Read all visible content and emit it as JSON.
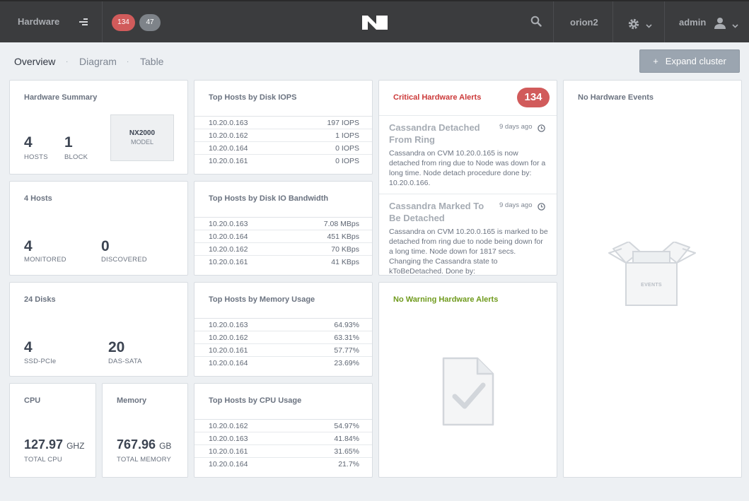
{
  "topbar": {
    "title": "Hardware",
    "critical_count": "134",
    "warning_count": "47",
    "cluster_name": "orion2",
    "user": "admin",
    "icons": [
      "menu-icon",
      "nutanix-logo",
      "search-icon",
      "gear-icon",
      "user-icon",
      "chevron-down-icon"
    ]
  },
  "subnav": {
    "tabs": [
      "Overview",
      "Diagram",
      "Table"
    ],
    "separator": "·"
  },
  "expand_button": {
    "icon": "+",
    "label": "Expand cluster"
  },
  "summary": {
    "title": "Hardware Summary",
    "hosts_value": "4",
    "hosts_label": "HOSTS",
    "block_value": "1",
    "block_label": "BLOCK",
    "model_name": "NX2000",
    "model_label": "MODEL"
  },
  "hosts": {
    "title": "4 Hosts",
    "monitored_value": "4",
    "monitored_label": "MONITORED",
    "discovered_value": "0",
    "discovered_label": "DISCOVERED"
  },
  "disks": {
    "title": "24 Disks",
    "ssd_value": "4",
    "ssd_label": "SSD-PCIe",
    "das_value": "20",
    "das_label": "DAS-SATA"
  },
  "cpu": {
    "title": "CPU",
    "value": "127.97",
    "unit": "GHZ",
    "label": "TOTAL CPU"
  },
  "memory": {
    "title": "Memory",
    "value": "767.96",
    "unit": "GB",
    "label": "TOTAL MEMORY"
  },
  "top_iops": {
    "title": "Top Hosts by Disk IOPS",
    "rows": [
      {
        "host": "10.20.0.163",
        "value": "197 IOPS"
      },
      {
        "host": "10.20.0.162",
        "value": "1 IOPS"
      },
      {
        "host": "10.20.0.164",
        "value": "0 IOPS"
      },
      {
        "host": "10.20.0.161",
        "value": "0 IOPS"
      }
    ]
  },
  "top_bw": {
    "title": "Top Hosts by Disk IO Bandwidth",
    "rows": [
      {
        "host": "10.20.0.163",
        "value": "7.08 MBps"
      },
      {
        "host": "10.20.0.164",
        "value": "451 KBps"
      },
      {
        "host": "10.20.0.162",
        "value": "70 KBps"
      },
      {
        "host": "10.20.0.161",
        "value": "41 KBps"
      }
    ]
  },
  "top_mem": {
    "title": "Top Hosts by Memory Usage",
    "rows": [
      {
        "host": "10.20.0.163",
        "value": "64.93%"
      },
      {
        "host": "10.20.0.162",
        "value": "63.31%"
      },
      {
        "host": "10.20.0.161",
        "value": "57.77%"
      },
      {
        "host": "10.20.0.164",
        "value": "23.69%"
      }
    ]
  },
  "top_cpu": {
    "title": "Top Hosts by CPU Usage",
    "rows": [
      {
        "host": "10.20.0.162",
        "value": "54.97%"
      },
      {
        "host": "10.20.0.163",
        "value": "41.84%"
      },
      {
        "host": "10.20.0.161",
        "value": "31.65%"
      },
      {
        "host": "10.20.0.164",
        "value": "21.7%"
      }
    ]
  },
  "critical_alerts": {
    "title": "Critical Hardware Alerts",
    "count": "134",
    "items": [
      {
        "title": "Cassandra Detached From Ring",
        "ago": "9 days ago",
        "desc": "Cassandra on CVM 10.20.0.165 is now detached from ring due to Node was down for a long time. Node detach procedure done by: 10.20.0.166."
      },
      {
        "title": "Cassandra Marked To Be Detached",
        "ago": "9 days ago",
        "desc": "Cassandra on CVM 10.20.0.165 is marked to be detached from ring due to node being down for a long time. Node down for 1817 secs. Changing the Cassandra state to kToBeDetached. Done by:"
      }
    ]
  },
  "warning_alerts": {
    "title": "No Warning Hardware Alerts"
  },
  "events": {
    "title": "No Hardware Events",
    "box_label": "EVENTS"
  },
  "colors": {
    "critical": "#cc3a3a",
    "warning_title": "#6f9a1c",
    "badge": "#d15b5b",
    "pill_gray": "#7e8389",
    "topbar": "#3b3c3e"
  }
}
